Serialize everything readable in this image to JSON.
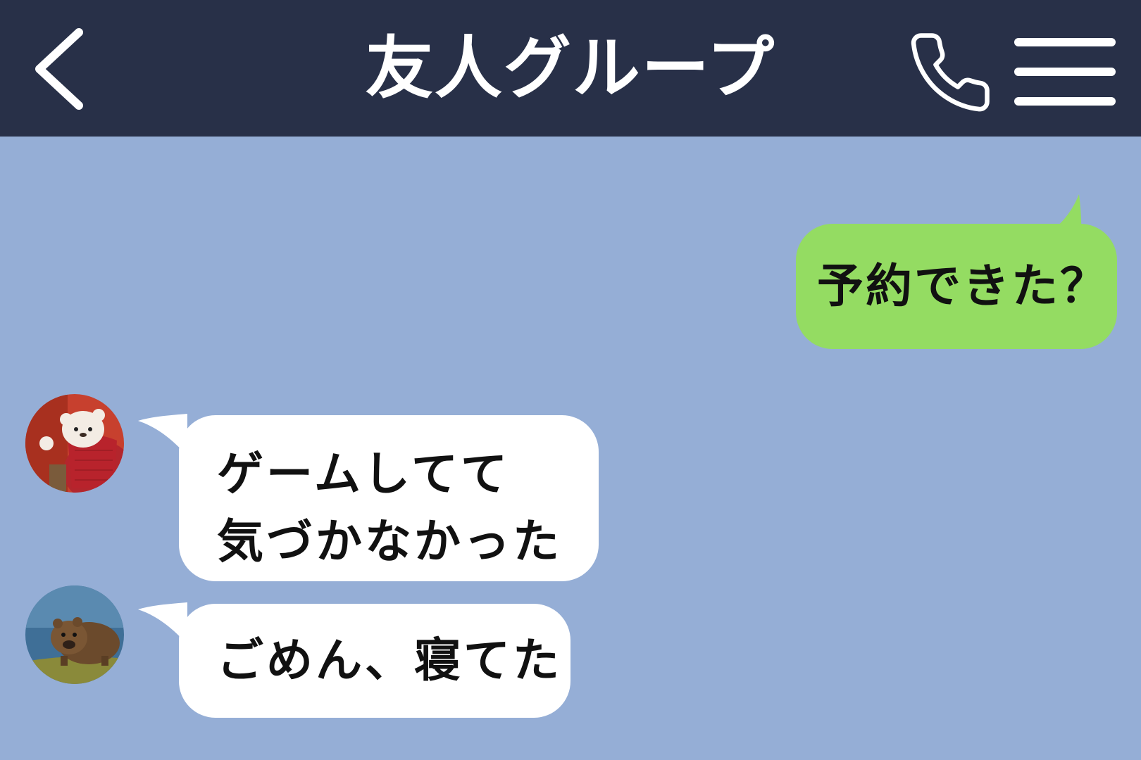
{
  "header": {
    "title": "友人グループ",
    "back_icon": "chevron-left-icon",
    "call_icon": "phone-icon",
    "menu_icon": "hamburger-menu-icon",
    "background_color": "#283048"
  },
  "chat": {
    "background_color": "#95aed6",
    "messages": [
      {
        "direction": "outgoing",
        "lines": [
          "予約できた？"
        ],
        "bubble_color": "#94dc62"
      },
      {
        "direction": "incoming",
        "avatar": "crochet-toy-avatar",
        "lines": [
          "ゲームしてて",
          "気づかなかった"
        ],
        "bubble_color": "#ffffff"
      },
      {
        "direction": "incoming",
        "avatar": "wombat-avatar",
        "lines": [
          "ごめん、寝てた"
        ],
        "bubble_color": "#ffffff"
      }
    ]
  }
}
